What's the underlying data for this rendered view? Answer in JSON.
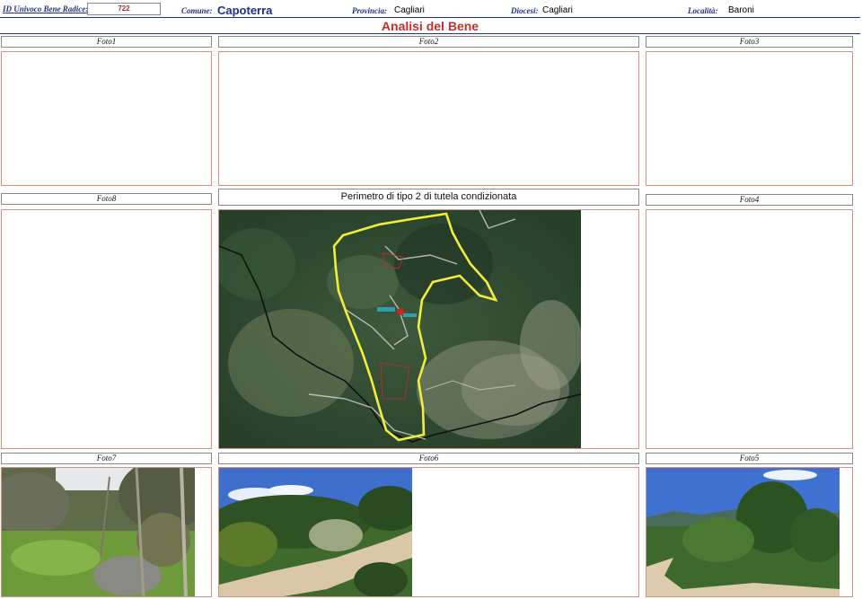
{
  "header": {
    "id_label": "ID Univoco Bene Radice:",
    "id_value": "722",
    "comune_label": "Comune:",
    "comune_value": "Capoterra",
    "provincia_label": "Provincia:",
    "provincia_value": "Cagliari",
    "diocesi_label": "Diocesi:",
    "diocesi_value": "Cagliari",
    "localita_label": "Località:",
    "localita_value": "Baroni"
  },
  "title": "Analisi del Bene",
  "photos": {
    "foto1": "Foto1",
    "foto2": "Foto2",
    "foto3": "Foto3",
    "foto8": "Foto8",
    "foto4": "Foto4",
    "foto7": "Foto7",
    "foto6": "Foto6",
    "foto5": "Foto5"
  },
  "map_caption": "Perimetro di tipo 2 di tutela condizionata",
  "colors": {
    "label_blue": "#1f2f8f",
    "title_red": "#c0302a",
    "box_border": "#d98d86",
    "perimeter_yellow": "#f2ee3a"
  }
}
